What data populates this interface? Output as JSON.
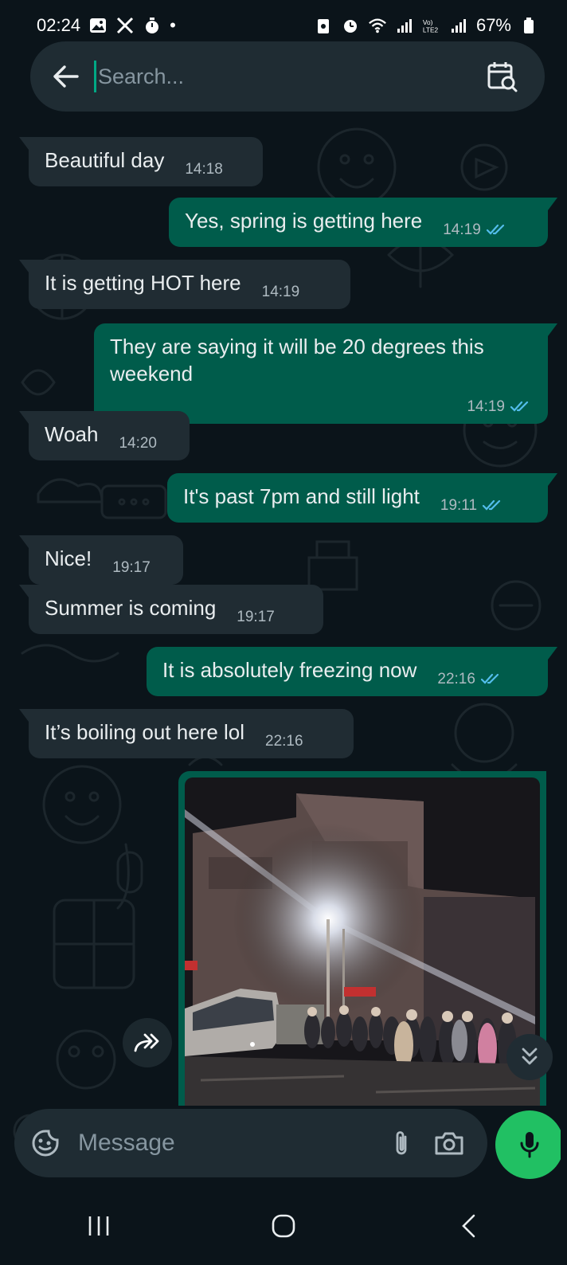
{
  "status_bar": {
    "time": "02:24",
    "battery": "67%",
    "dot": "•"
  },
  "search": {
    "placeholder": "Search..."
  },
  "messages": [
    {
      "direction": "in",
      "text": "Beautiful day",
      "time": "14:18"
    },
    {
      "direction": "out",
      "text": "Yes, spring is getting here",
      "time": "14:19",
      "read": true
    },
    {
      "direction": "in",
      "text": "It is getting HOT here",
      "time": "14:19"
    },
    {
      "direction": "out",
      "text": "They are saying it will be 20 degrees this weekend",
      "time": "14:19",
      "read": true
    },
    {
      "direction": "in",
      "text": "Woah",
      "time": "14:20"
    },
    {
      "direction": "out",
      "text": "It's past 7pm and still light",
      "time": "19:11",
      "read": true
    },
    {
      "direction": "in",
      "text": "Nice!",
      "time": "19:17"
    },
    {
      "direction": "in",
      "text": "Summer is coming",
      "time": "19:17"
    },
    {
      "direction": "out",
      "text": "It is absolutely freezing now",
      "time": "22:16",
      "read": true
    },
    {
      "direction": "in",
      "text": "It’s boiling out here lol",
      "time": "22:16"
    }
  ],
  "composer": {
    "placeholder": "Message"
  },
  "colors": {
    "background": "#0b141a",
    "incoming_bubble": "#202c33",
    "outgoing_bubble": "#005c4b",
    "read_ticks": "#53bdeb",
    "accent": "#21c063"
  },
  "icons": {
    "back": "arrow-left-icon",
    "calendar_search": "calendar-search-icon",
    "forward": "forward-icon",
    "scroll_down": "double-chevron-down-icon",
    "emoji": "sticker-icon",
    "attach": "paperclip-icon",
    "camera": "camera-icon",
    "mic": "microphone-icon"
  }
}
